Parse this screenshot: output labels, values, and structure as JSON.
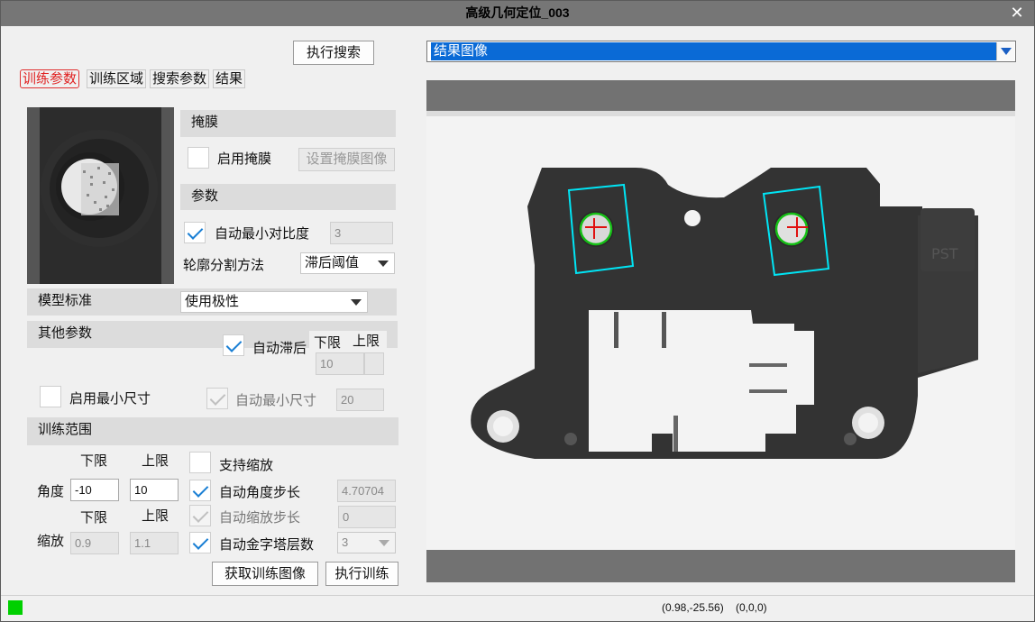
{
  "window": {
    "title": "高级几何定位_003",
    "close": "✕"
  },
  "toolbar": {
    "search_button": "执行搜索"
  },
  "tabs": [
    "训练参数",
    "训练区域",
    "搜索参数",
    "结果"
  ],
  "view_select": {
    "value": "结果图像"
  },
  "mask": {
    "section": "掩膜",
    "enable_label": "启用掩膜",
    "set_button": "设置掩膜图像"
  },
  "params": {
    "section": "参数",
    "auto_min_contrast_label": "自动最小对比度",
    "auto_min_contrast_value": "3",
    "contour_method_label": "轮廓分割方法",
    "contour_method_value": "滞后阈值"
  },
  "model": {
    "label": "模型标准",
    "value": "使用极性"
  },
  "other": {
    "section": "其他参数",
    "auto_hysteresis_label": "自动滞后",
    "lower_label": "下限",
    "upper_label": "上限",
    "hysteresis_lower": "10",
    "min_size_enable_label": "启用最小尺寸",
    "auto_min_size_label": "自动最小尺寸",
    "auto_min_size_value": "20"
  },
  "train_range": {
    "section": "训练范围",
    "lower_label": "下限",
    "upper_label": "上限",
    "angle_label": "角度",
    "angle_lower": "-10",
    "angle_upper": "10",
    "scale_label": "缩放",
    "scale_lower": "0.9",
    "scale_upper": "1.1",
    "support_scale_label": "支持缩放",
    "auto_angle_step_label": "自动角度步长",
    "auto_angle_step_value": "4.70704",
    "auto_scale_step_label": "自动缩放步长",
    "auto_scale_step_value": "0",
    "auto_pyramid_label": "自动金字塔层数",
    "auto_pyramid_value": "3"
  },
  "buttons": {
    "get_train_image": "获取训练图像",
    "run_train": "执行训练"
  },
  "status": {
    "coords": "(0.98,-25.56)",
    "pixel": "(0,0,0)",
    "indicator_color": "#00d000"
  },
  "colors": {
    "roi": "#00e5f5",
    "match": "#16c016",
    "cross": "#e01010",
    "accent": "#1a7fd4"
  }
}
